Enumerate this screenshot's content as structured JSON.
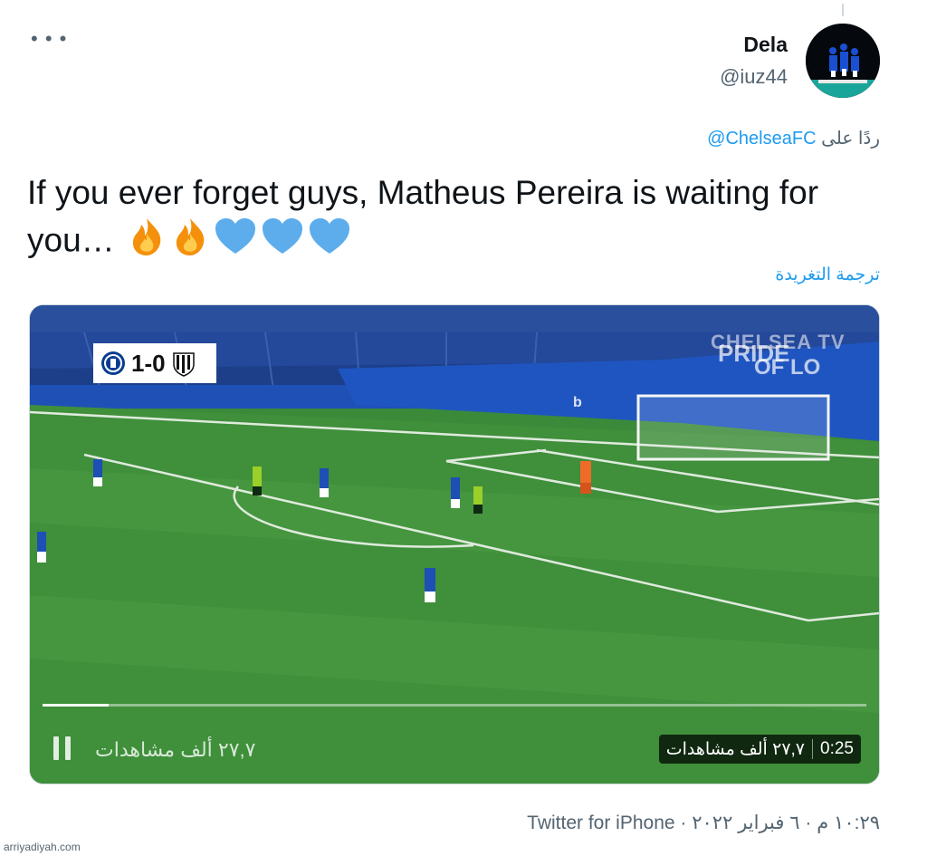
{
  "tweet": {
    "author": {
      "display_name": "Dela",
      "handle": "@iuz44"
    },
    "more_icon": "more-horizontal-icon",
    "reply_to_prefix": "ردًا على ",
    "reply_to_handle": "ChelseaFC@",
    "text_line": "If you ever forget guys, Matheus Pereira is waiting for you…",
    "emojis": [
      "fire-emoji",
      "fire-emoji",
      "blue-heart-emoji",
      "blue-heart-emoji",
      "blue-heart-emoji"
    ],
    "translate_label": "ترجمة التغريدة",
    "footer": "١٠:٢٩ م · ٦ فبراير ٢٠٢٢ · Twitter for iPhone"
  },
  "video": {
    "score": "1-0",
    "watermark": "CHELSEA TV",
    "views": "٢٧,٧ ألف مشاهدات",
    "duration": "0:25",
    "progress": 0.08,
    "pause_icon": "pause-icon"
  },
  "site_credit": "arriyadiyah.com",
  "colors": {
    "accent": "#1d9bf0",
    "secondary_text": "#536471",
    "pitch_green": "#3f8f3b"
  }
}
